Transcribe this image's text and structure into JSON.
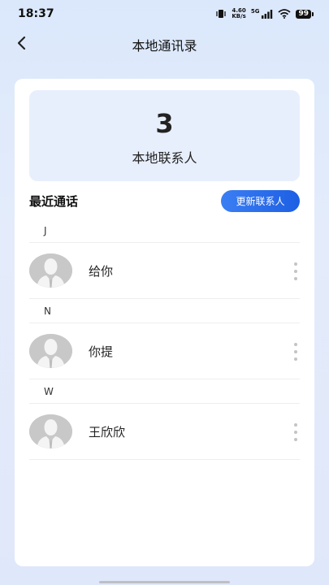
{
  "status_bar": {
    "time": "18:37",
    "net_speed_value": "4.60",
    "net_speed_unit": "KB/s",
    "network": "5G",
    "battery": "99"
  },
  "header": {
    "title": "本地通讯录",
    "back_icon": "chevron-left-icon"
  },
  "summary": {
    "count": "3",
    "label": "本地联系人"
  },
  "section": {
    "title": "最近通话",
    "update_button": "更新联系人"
  },
  "groups": [
    {
      "letter": "J",
      "contacts": [
        {
          "name": "给你"
        }
      ]
    },
    {
      "letter": "N",
      "contacts": [
        {
          "name": "你提"
        }
      ]
    },
    {
      "letter": "W",
      "contacts": [
        {
          "name": "王欣欣"
        }
      ]
    }
  ],
  "colors": {
    "accent": "#1d5fe4",
    "summary_bg": "#e8effc",
    "page_bg": "#dbe8fb"
  }
}
